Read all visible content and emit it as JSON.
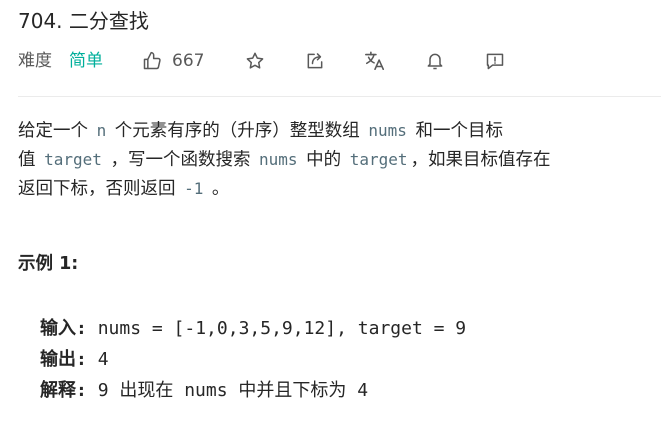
{
  "problem": {
    "title": "704. 二分查找",
    "difficulty_label": "难度",
    "difficulty_value": "简单",
    "likes": "667"
  },
  "description": {
    "l1_a": "给定一个",
    "l1_code1": "n",
    "l1_b": "个元素有序的（升序）整型数组",
    "l1_code2": "nums",
    "l1_c": "和一个目标",
    "l2_a": "值",
    "l2_code1": "target",
    "l2_b": "，写一个函数搜索",
    "l2_code2": "nums",
    "l2_c": "中的",
    "l2_code3": "target",
    "l2_d": "，如果目标值存在",
    "l3_a": "返回下标，否则返回",
    "l3_code1": "-1",
    "l3_b": "。"
  },
  "example": {
    "title": "示例 1:",
    "input_label": "输入:",
    "input_value": "nums = [-1,0,3,5,9,12], target = 9",
    "output_label": "输出:",
    "output_value": "4",
    "explain_label": "解释:",
    "explain_value": "9 出现在 nums 中并且下标为 4"
  },
  "icons": [
    "thumbs-up-icon",
    "star-icon",
    "share-icon",
    "translate-icon",
    "bell-icon",
    "feedback-icon"
  ],
  "colors": {
    "difficulty_easy": "#00af9b",
    "text": "#262626",
    "muted": "#595959",
    "code": "#546e7a"
  }
}
